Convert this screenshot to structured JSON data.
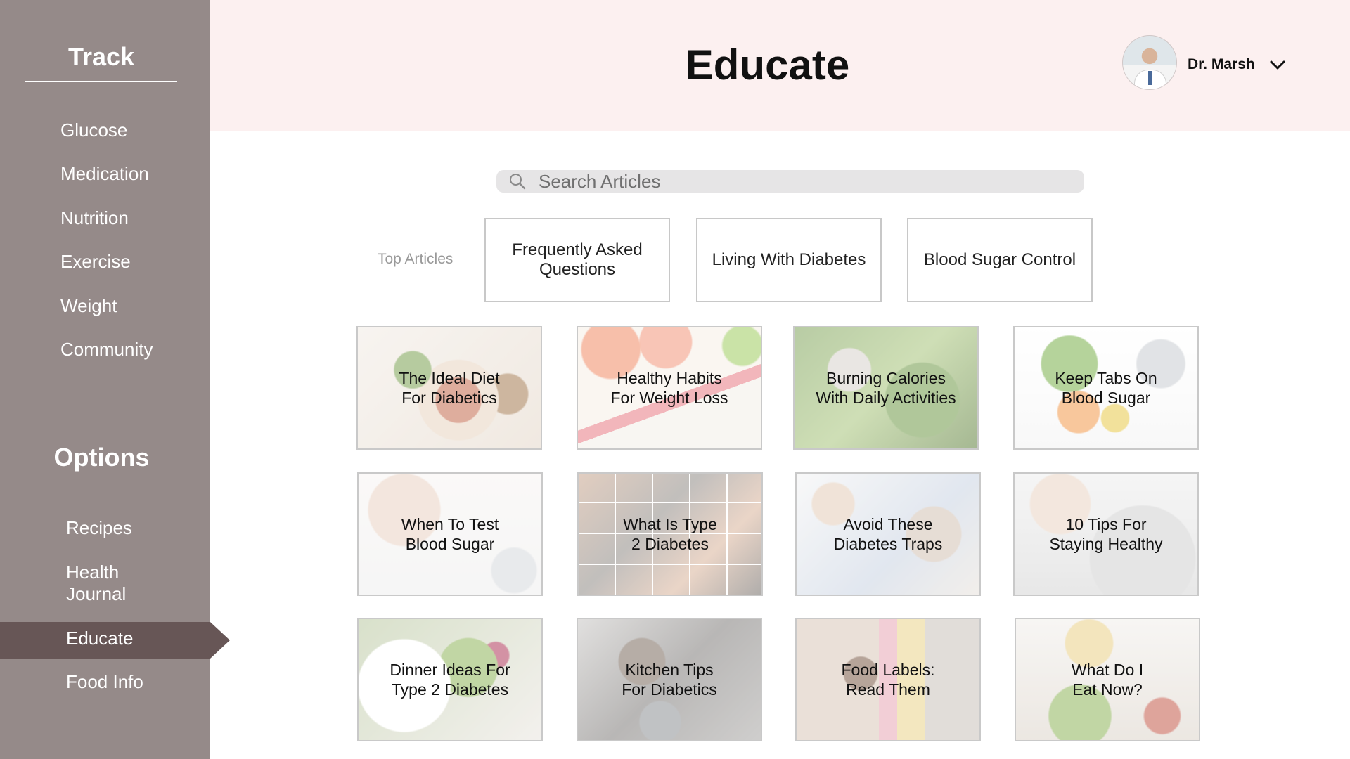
{
  "sidebar": {
    "track_title": "Track",
    "track_items": [
      "Glucose",
      "Medication",
      "Nutrition",
      "Exercise",
      "Weight",
      "Community"
    ],
    "options_title": "Options",
    "options_items": [
      "Recipes",
      "Health\nJournal",
      "Educate",
      "Food Info"
    ],
    "active_item": "Educate"
  },
  "header": {
    "title": "Educate",
    "user_name": "Dr. Marsh"
  },
  "search": {
    "placeholder": "Search Articles"
  },
  "top_articles": {
    "label": "Top Articles",
    "items": [
      "Frequently Asked Questions",
      "Living With Diabetes",
      "Blood Sugar Control"
    ]
  },
  "articles": [
    "The Ideal Diet\nFor Diabetics",
    "Healthy Habits\nFor Weight Loss",
    "Burning Calories\nWith Daily Activities",
    "Keep Tabs On\nBlood Sugar",
    "When To Test\nBlood Sugar",
    "What Is Type\n2 Diabetes",
    "Avoid These\nDiabetes Traps",
    "10 Tips For\nStaying Healthy",
    "Dinner Ideas For\nType 2 Diabetes",
    "Kitchen Tips\nFor Diabetics",
    "Food Labels:\nRead Them",
    "What Do I\nEat Now?"
  ],
  "colors": {
    "sidebar": "#958a89",
    "active_item": "#675656",
    "header": "#fcf0f0"
  }
}
